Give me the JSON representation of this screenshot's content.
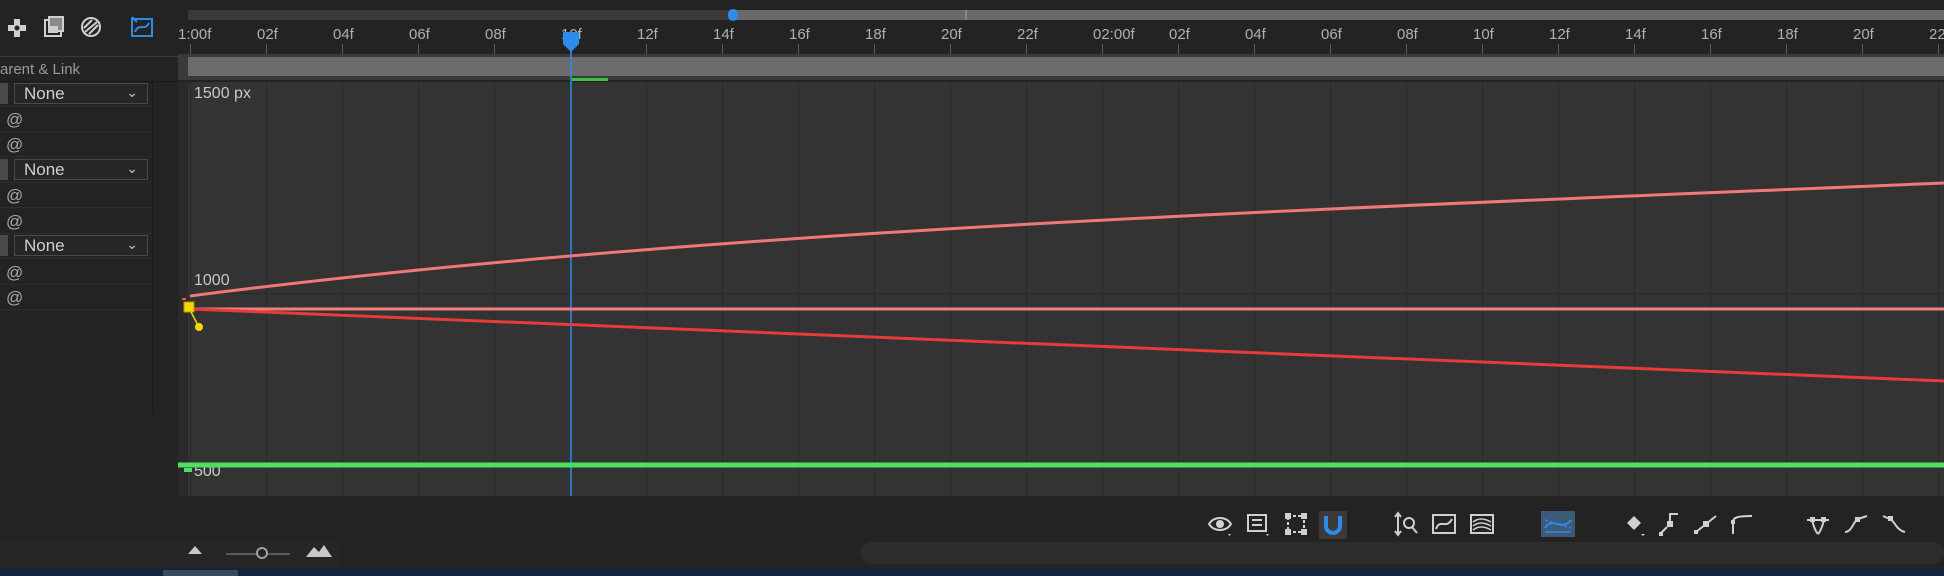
{
  "panel": {
    "title": "arent & Link",
    "rows": [
      {
        "type": "dropdown",
        "value": "None"
      },
      {
        "type": "spiral"
      },
      {
        "type": "spiral"
      },
      {
        "type": "dropdown",
        "value": "None"
      },
      {
        "type": "spiral"
      },
      {
        "type": "spiral"
      },
      {
        "type": "dropdown",
        "value": "None"
      },
      {
        "type": "spiral"
      },
      {
        "type": "spiral"
      }
    ]
  },
  "ruler": {
    "ticks": [
      "1:00f",
      "02f",
      "04f",
      "06f",
      "08f",
      "10f",
      "12f",
      "14f",
      "16f",
      "18f",
      "20f",
      "22f",
      "02:00f",
      "02f",
      "04f",
      "06f",
      "08f",
      "10f",
      "12f",
      "14f",
      "16f",
      "18f",
      "20f",
      "22"
    ]
  },
  "graph": {
    "y_labels": {
      "top": "1500 px",
      "mid": "1000",
      "bottom": "500"
    }
  },
  "colors": {
    "playhead": "#2d8ceb",
    "curve_light": "#f07878",
    "curve_mid": "#f08080",
    "curve_red": "#e53b3b",
    "curve_green": "#4ee060",
    "keyframe": "#f5d800"
  },
  "icons": {
    "top": [
      "anchor-icon",
      "film-icon",
      "mask-icon",
      "graph-editor-icon"
    ],
    "bottom": [
      "eye-icon",
      "properties-icon",
      "transform-box-icon",
      "snap-icon",
      "fit-selection-icon",
      "fit-all-icon",
      "auto-zoom-icon",
      "graph-type-icon",
      "keyframe-icon",
      "convert-keyframe-icon",
      "easy-ease-icon",
      "ease-in-icon",
      "ease-out-icon",
      "separate-dimensions-icon",
      "hold-icon",
      "linear-icon"
    ]
  }
}
